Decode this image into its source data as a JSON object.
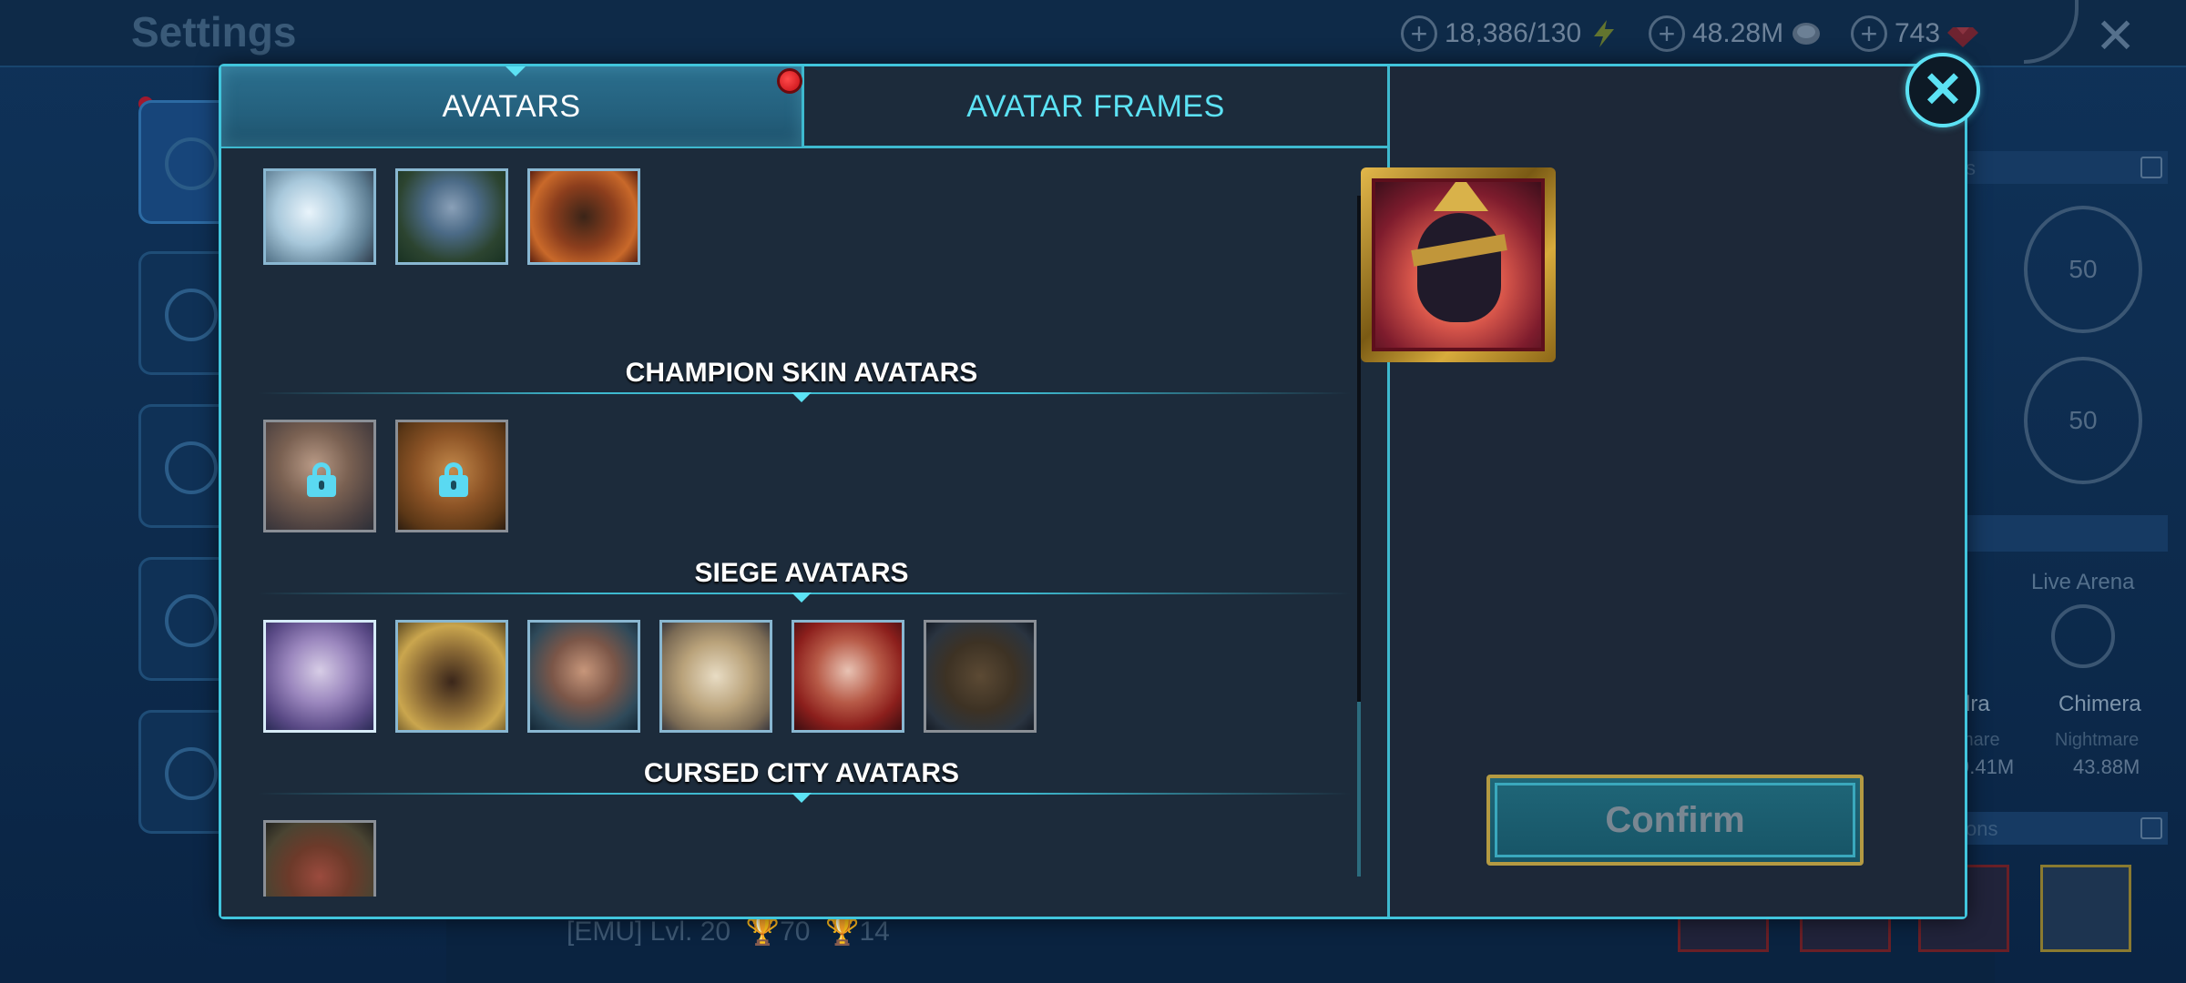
{
  "header": {
    "title": "Settings",
    "resources": [
      {
        "value": "18,386/130",
        "icon": "energy-icon"
      },
      {
        "value": "48.28M",
        "icon": "silver-icon"
      },
      {
        "value": "743",
        "icon": "gem-icon"
      }
    ],
    "close_icon": "close-icon"
  },
  "background": {
    "live_arena_label": "Live Arena",
    "badge_level_1": "50",
    "badge_level_2": "50",
    "col1_name": "dra",
    "col1_diff": "mare",
    "col1_value": "9.41M",
    "col2_name": "Chimera",
    "col2_diff": "Nightmare",
    "col2_value": "43.88M",
    "bar1_text": "s",
    "bar2_text": "ons",
    "footer_name": "[EMU] Lvl. 20",
    "footer_stat1": "70",
    "footer_stat2": "14"
  },
  "modal": {
    "tabs": {
      "avatars": "AVATARS",
      "avatar_frames": "AVATAR FRAMES",
      "active": "avatars"
    },
    "sections": [
      {
        "title": "CHAMPION SKIN AVATARS"
      },
      {
        "title": "SIEGE AVATARS"
      },
      {
        "title": "CURSED CITY AVATARS"
      }
    ],
    "top_row_avatar_icons": [
      "frost-beast-avatar-icon",
      "forest-elder-avatar-icon",
      "lion-demon-avatar-icon"
    ],
    "champion_skin_avatar_icons": [
      "elf-queen-locked-avatar-icon",
      "ape-warrior-locked-avatar-icon"
    ],
    "siege_avatar_icons": [
      "pale-sorceress-avatar-icon",
      "golden-ape-avatar-icon",
      "scarred-warrior-avatar-icon",
      "white-lion-avatar-icon",
      "crimson-queen-avatar-icon",
      "orc-brute-avatar-icon"
    ],
    "cursed_city_avatar_icons": [
      "horned-demon-avatar-icon"
    ],
    "preview_icon": "panther-pharaoh-avatar-icon",
    "confirm_label": "Confirm",
    "colors": {
      "accent": "#5ce2f4",
      "border": "#41c5dc",
      "panel": "#1c2b3b",
      "confirm_border": "#b49a42"
    }
  }
}
